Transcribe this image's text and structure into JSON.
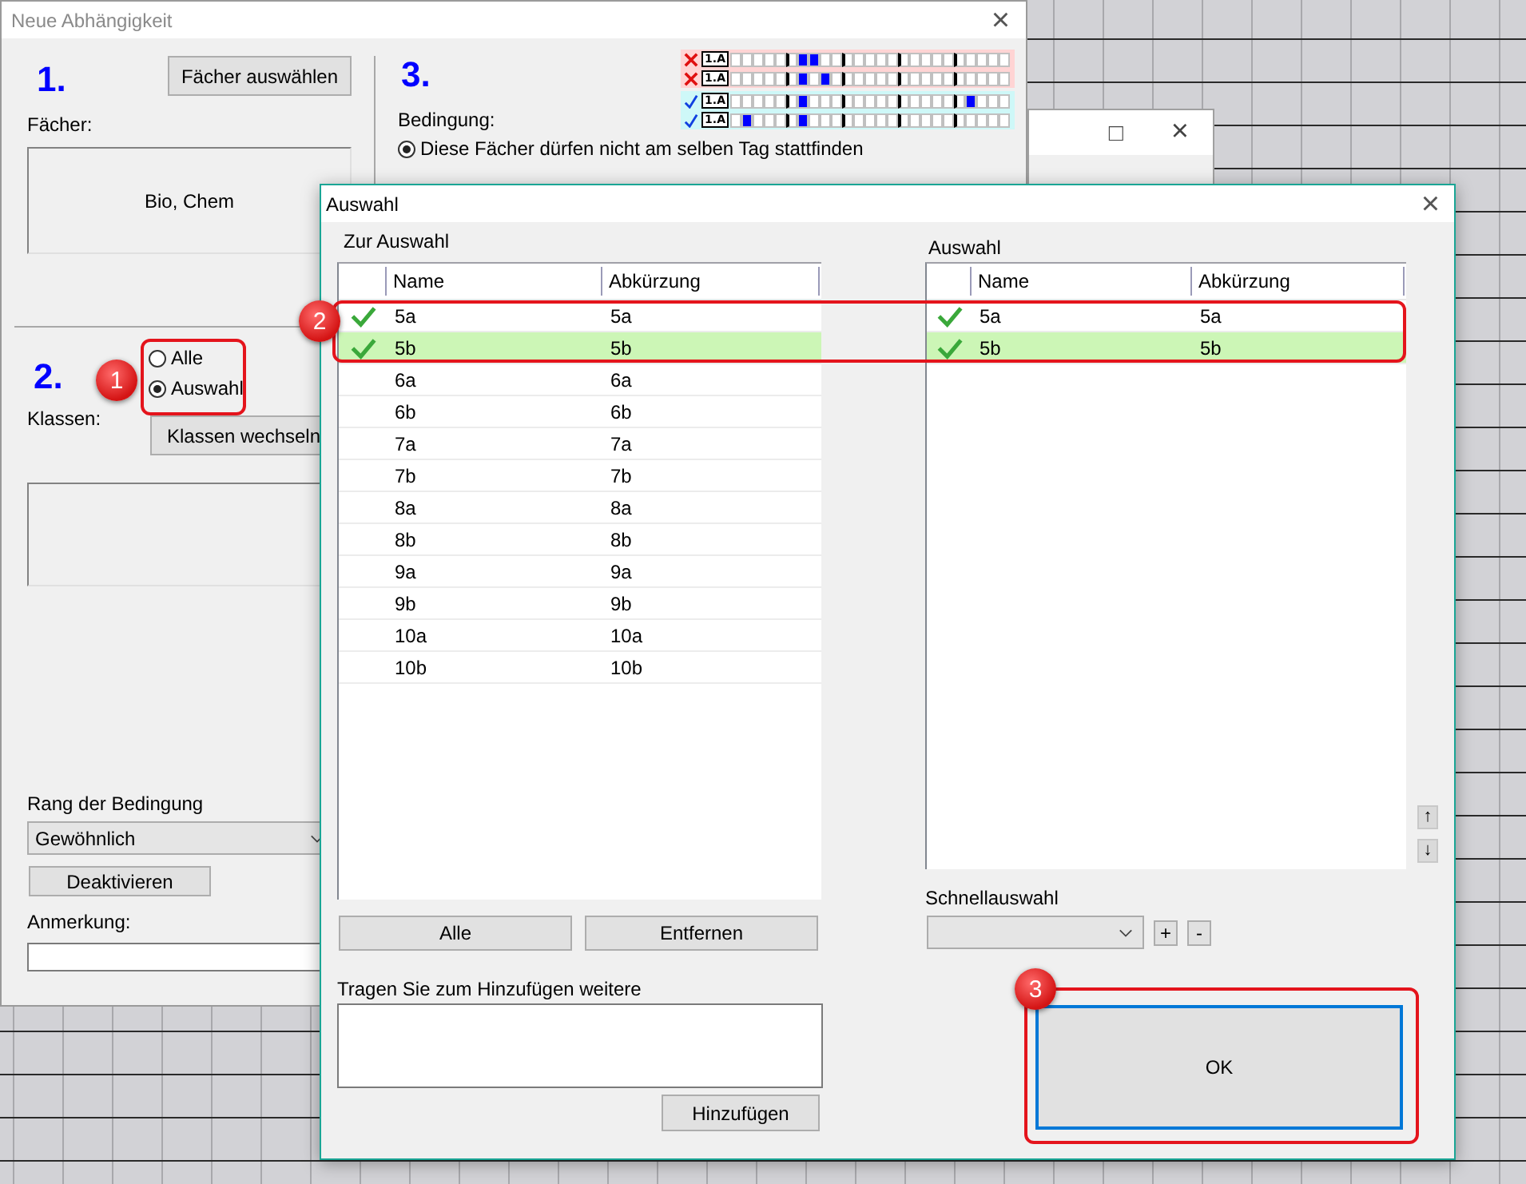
{
  "main_window": {
    "title": "Neue Abhängigkeit",
    "close": "×",
    "step1": {
      "number": "1.",
      "button": "Fächer auswählen",
      "label": "Fächer:",
      "subjects": "Bio, Chem"
    },
    "step3": {
      "number": "3.",
      "label": "Bedingung:",
      "pattern_rows": [
        {
          "kind": "conflict",
          "label": "1.A",
          "cells": [
            false,
            false,
            false,
            false,
            false,
            false,
            true,
            true,
            false,
            false,
            false,
            false,
            false,
            false,
            false,
            false,
            false,
            false,
            false,
            false,
            false,
            false,
            false,
            false,
            false
          ]
        },
        {
          "kind": "conflict",
          "label": "1.A",
          "cells": [
            false,
            false,
            false,
            false,
            false,
            false,
            true,
            false,
            true,
            false,
            false,
            false,
            false,
            false,
            false,
            false,
            false,
            false,
            false,
            false,
            false,
            false,
            false,
            false,
            false
          ]
        },
        {
          "kind": "ok",
          "label": "1.A",
          "cells": [
            false,
            false,
            false,
            false,
            false,
            false,
            true,
            false,
            false,
            false,
            false,
            false,
            false,
            false,
            false,
            false,
            false,
            false,
            false,
            false,
            false,
            true,
            false,
            false,
            false
          ]
        },
        {
          "kind": "ok",
          "label": "1.A",
          "cells": [
            false,
            true,
            false,
            false,
            false,
            false,
            true,
            false,
            false,
            false,
            false,
            false,
            false,
            false,
            false,
            false,
            false,
            false,
            false,
            false,
            false,
            false,
            false,
            false,
            false
          ]
        }
      ],
      "options": [
        {
          "label": "Diese Fächer dürfen nicht am selben Tag stattfinden",
          "selected": true
        }
      ]
    },
    "step2": {
      "number": "2.",
      "label": "Klassen:",
      "options": [
        {
          "label": "Alle",
          "selected": false
        },
        {
          "label": "Auswahl",
          "selected": true
        }
      ],
      "button": "Klassen wechseln"
    },
    "rank": {
      "label": "Rang der Bedingung",
      "value": "Gewöhnlich"
    },
    "deactivate_button": "Deaktivieren",
    "note": {
      "label": "Anmerkung:"
    }
  },
  "other_window": {
    "maximize": "□",
    "close": "×"
  },
  "dialog": {
    "title": "Auswahl",
    "close": "×",
    "available": {
      "label": "Zur Auswahl",
      "columns": [
        "Name",
        "Abkürzung"
      ],
      "rows": [
        {
          "name": "5a",
          "abbreviation": "5a",
          "checked": true,
          "selected": false
        },
        {
          "name": "5b",
          "abbreviation": "5b",
          "checked": true,
          "selected": true
        },
        {
          "name": "6a",
          "abbreviation": "6a",
          "checked": false,
          "selected": false
        },
        {
          "name": "6b",
          "abbreviation": "6b",
          "checked": false,
          "selected": false
        },
        {
          "name": "7a",
          "abbreviation": "7a",
          "checked": false,
          "selected": false
        },
        {
          "name": "7b",
          "abbreviation": "7b",
          "checked": false,
          "selected": false
        },
        {
          "name": "8a",
          "abbreviation": "8a",
          "checked": false,
          "selected": false
        },
        {
          "name": "8b",
          "abbreviation": "8b",
          "checked": false,
          "selected": false
        },
        {
          "name": "9a",
          "abbreviation": "9a",
          "checked": false,
          "selected": false
        },
        {
          "name": "9b",
          "abbreviation": "9b",
          "checked": false,
          "selected": false
        },
        {
          "name": "10a",
          "abbreviation": "10a",
          "checked": false,
          "selected": false
        },
        {
          "name": "10b",
          "abbreviation": "10b",
          "checked": false,
          "selected": false
        }
      ]
    },
    "buttons": [
      "Alle",
      "Entfernen"
    ],
    "add": {
      "label": "Tragen Sie zum Hinzufügen weitere",
      "button": "Hinzufügen"
    },
    "selection": {
      "label": "Auswahl",
      "columns": [
        "Name",
        "Abkürzung"
      ],
      "rows": [
        {
          "name": "5a",
          "abbreviation": "5a",
          "checked": true,
          "selected": false
        },
        {
          "name": "5b",
          "abbreviation": "5b",
          "checked": true,
          "selected": true
        }
      ],
      "move_buttons": [
        "↑",
        "↓"
      ]
    },
    "quick_select": {
      "label": "Schnellauswahl",
      "buttons": [
        "+",
        "-"
      ]
    },
    "ok_button": "OK"
  },
  "annotations": [
    {
      "number": "1"
    },
    {
      "number": "2"
    },
    {
      "number": "3"
    }
  ]
}
